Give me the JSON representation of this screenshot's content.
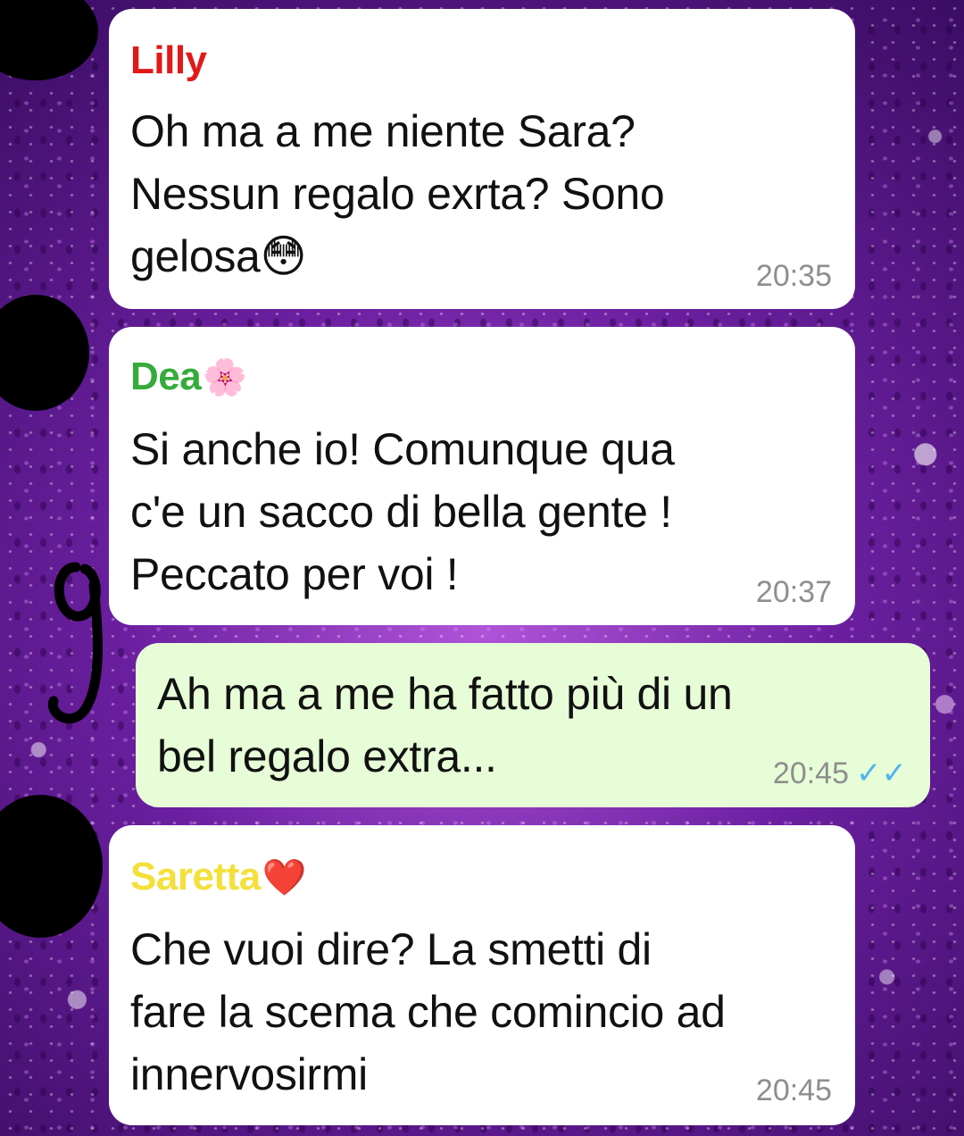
{
  "colors": {
    "lilly": "#e11919",
    "dea": "#35ab3c",
    "saretta": "#f4e03a",
    "incoming_bubble": "#ffffff",
    "outgoing_bubble": "#e7fdd8",
    "read_ticks": "#4fb6ec"
  },
  "messages": [
    {
      "sender": "Lilly",
      "sender_emoji": "",
      "text": "Oh ma a me niente Sara?\nNessun regalo exrta? Sono\ngelosa😳",
      "time": "20:35"
    },
    {
      "sender": "Dea",
      "sender_emoji": "🌸",
      "text": "Si anche io! Comunque qua\nc'e un sacco di bella gente !\nPeccato per voi !",
      "time": "20:37"
    },
    {
      "sender": "",
      "sender_emoji": "",
      "text": "Ah ma a me ha fatto più di un\nbel regalo extra...",
      "time": "20:45",
      "ticks": "✓✓",
      "ticks_icon": "read-double-check-icon"
    },
    {
      "sender": "Saretta",
      "sender_emoji": "❤️",
      "text": "Che vuoi dire? La smetti di\nfare la scema che comincio ad\ninnervosirmi",
      "time": "20:45"
    }
  ]
}
